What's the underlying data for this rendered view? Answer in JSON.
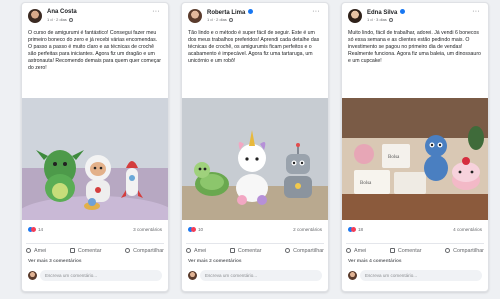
{
  "posts": [
    {
      "author": "Ana Costa",
      "meta": "1 d · 2 dias",
      "text": "O curso de amigurumi é fantástico! Consegui fazer meu primeiro boneco do zero e já recebi várias encomendas. O passo a passo é muito claro e as técnicas de crochê são perfeitas para iniciantes. Agora fiz um dragão e um astronauta! Recomendo demais para quem quer começar do zero!",
      "reactions": "14",
      "comments": "3 comentários",
      "actions": [
        "Amei",
        "Comentar",
        "Compartilhar"
      ],
      "see_more": "Ver mais 3 comentários",
      "comment_placeholder": "Escreva um comentário..."
    },
    {
      "author": "Roberta Lima",
      "meta": "1 d · 2 dias",
      "text": "Tão lindo e o método é super fácil de seguir. Este é um dos meus trabalhos preferidos! Aprendi cada detalhe das técnicas de crochê, os amigurumis ficam perfeitos e o acabamento é impecável. Agora fiz uma tartaruga, um unicórnio e um robô!",
      "reactions": "10",
      "comments": "2 comentários",
      "actions": [
        "Amei",
        "Comentar",
        "Compartilhar"
      ],
      "see_more": "Ver mais 2 comentários",
      "comment_placeholder": "Escreva um comentário..."
    },
    {
      "author": "Edna Silva",
      "meta": "1 d · 3 dias",
      "text": "Muito lindo, fácil de trabalhar, adorei. Já vendi 6 bonecos só essa semana e as clientes estão pedindo mais. O investimento se pagou no primeiro dia de vendas! Realmente funciona. Agora fiz uma baleia, um dinossauro e um cupcake!",
      "reactions": "18",
      "comments": "4 comentários",
      "actions": [
        "Amei",
        "Comentar",
        "Compartilhar"
      ],
      "see_more": "Ver mais 4 comentários",
      "comment_placeholder": "Escreva um comentário..."
    }
  ],
  "image_labels": {
    "box_a": "Bolsa",
    "box_b": "Bolsa"
  },
  "colors": {
    "like": "#1877f2",
    "love": "#f33e58",
    "text": "#1c1e21",
    "muted": "#65676b"
  }
}
